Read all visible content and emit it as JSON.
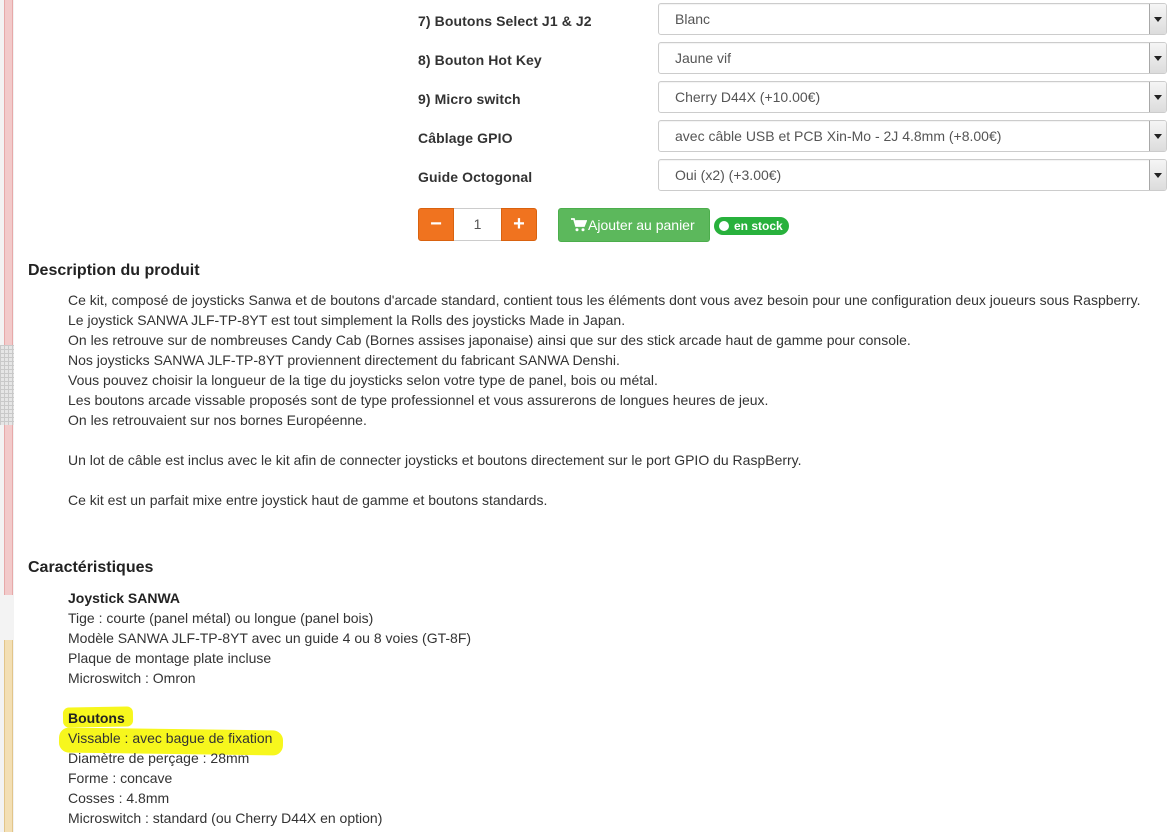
{
  "options": [
    {
      "label": "7) Boutons Select J1 & J2",
      "value": "Blanc"
    },
    {
      "label": "8) Bouton Hot Key",
      "value": "Jaune vif"
    },
    {
      "label": "9) Micro switch",
      "value": "Cherry D44X (+10.00€)"
    },
    {
      "label": "Câblage GPIO",
      "value": "avec câble USB et PCB Xin-Mo - 2J 4.8mm (+8.00€)"
    },
    {
      "label": "Guide Octogonal",
      "value": "Oui (x2) (+3.00€)"
    }
  ],
  "purchase": {
    "minus": "−",
    "quantity": "1",
    "plus": "+",
    "cart_label": "Ajouter au panier",
    "stock_label": "en stock"
  },
  "description": {
    "title": "Description du produit",
    "lines": [
      "Ce kit, composé de joysticks Sanwa et de boutons d'arcade standard, contient tous les éléments dont vous avez besoin pour une configuration deux joueurs sous Raspberry.",
      "Le joystick SANWA JLF-TP-8YT est tout simplement la Rolls des joysticks Made in Japan.",
      "On les retrouve sur de nombreuses Candy Cab (Bornes assises japonaise) ainsi que sur des stick arcade haut de gamme pour console.",
      "Nos joysticks SANWA JLF-TP-8YT proviennent directement du fabricant SANWA Denshi.",
      "Vous pouvez choisir la longueur de la tige du joysticks selon votre type de panel, bois ou métal.",
      "Les boutons arcade vissable proposés sont de type professionnel et vous assurerons de longues heures de jeux.",
      "On les retrouvaient sur nos bornes Européenne.",
      "Un lot de câble est inclus avec le kit afin de connecter joysticks et boutons directement sur le port GPIO du RaspBerry.",
      "Ce kit est un parfait mixe entre joystick haut de gamme et boutons standards."
    ]
  },
  "characteristics": {
    "title": "Caractéristiques",
    "joystick": {
      "heading": "Joystick SANWA",
      "items": [
        "Tige : courte (panel métal) ou longue (panel bois)",
        "Modèle SANWA JLF-TP-8YT avec un guide 4 ou 8 voies (GT-8F)",
        "Plaque de montage plate incluse",
        "Microswitch : Omron"
      ]
    },
    "buttons": {
      "heading": "Boutons",
      "items": [
        "Vissable : avec bague de fixation",
        "Diamètre de perçage : 28mm",
        "Forme : concave",
        "Cosses : 4.8mm",
        "Microswitch : standard (ou Cherry D44X en option)"
      ]
    }
  },
  "colors": {
    "minus_plus": "#f0731f",
    "cart": "#5cb85c",
    "stock": "#28b13c",
    "highlight": "#f7f71d"
  },
  "icons": {
    "cart": "shopping-cart-icon",
    "select_arrow": "chevron-down-icon",
    "stock_dot": "circle-icon"
  }
}
